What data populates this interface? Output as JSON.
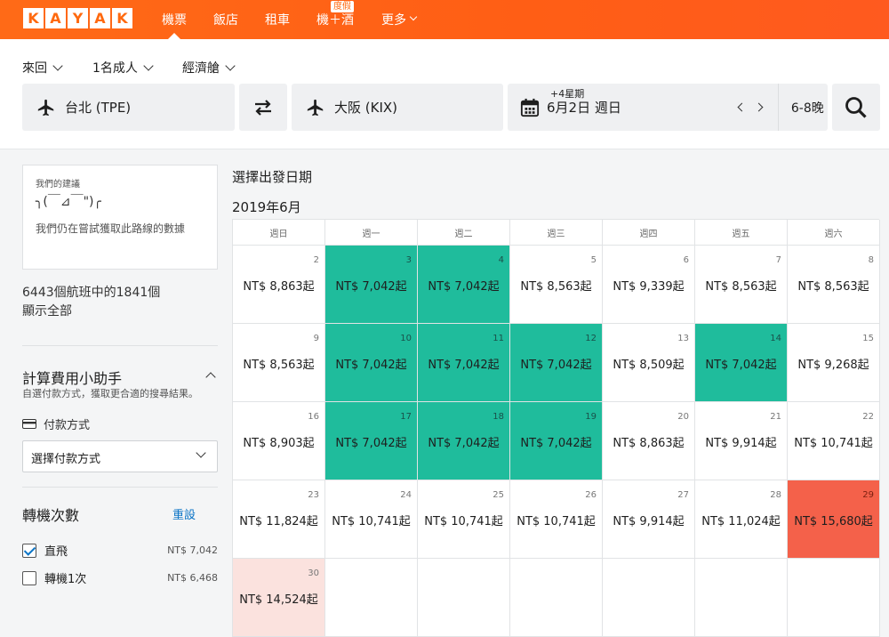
{
  "brand": {
    "letters": [
      "K",
      "A",
      "Y",
      "A",
      "K"
    ]
  },
  "nav": {
    "items": [
      {
        "label": "機票",
        "active": true
      },
      {
        "label": "飯店"
      },
      {
        "label": "租車"
      },
      {
        "label": "機＋酒",
        "badge": "度假"
      },
      {
        "label": "更多"
      }
    ]
  },
  "search": {
    "trip_type": "來回",
    "travelers": "1名成人",
    "cabin": "經濟艙",
    "origin": "台北 (TPE)",
    "destination": "大阪 (KIX)",
    "date": "6月2日 週日",
    "date_flex": "+4星期",
    "duration": "6-8晚"
  },
  "sidebar": {
    "advice_heading": "我們的建議",
    "advice_face": "╮(￣⊿￣\")╭",
    "advice_msg": "我們仍在嘗試獲取此路線的數據",
    "flight_count": "6443個航班中的1841個",
    "show_all": "顯示全部",
    "calc_title": "計算費用小助手",
    "calc_desc": "自選付款方式，獲取更合適的搜尋結果。",
    "payment_label": "付款方式",
    "payment_select": "選擇付款方式",
    "stops_title": "轉機次數",
    "reset": "重設",
    "stops": [
      {
        "label": "直飛",
        "price": "NT$ 7,042",
        "checked": true
      },
      {
        "label": "轉機1次",
        "price": "NT$ 6,468",
        "checked": false
      }
    ]
  },
  "calendar": {
    "title": "選擇出發日期",
    "month": "2019年6月",
    "weekdays": [
      "週日",
      "週一",
      "週二",
      "週三",
      "週四",
      "週五",
      "週六"
    ],
    "rows": [
      [
        {
          "day": "2",
          "price": "NT$ 8,863起",
          "level": "normal"
        },
        {
          "day": "3",
          "price": "NT$ 7,042起",
          "level": "low"
        },
        {
          "day": "4",
          "price": "NT$ 7,042起",
          "level": "low"
        },
        {
          "day": "5",
          "price": "NT$ 8,563起",
          "level": "normal"
        },
        {
          "day": "6",
          "price": "NT$ 9,339起",
          "level": "normal"
        },
        {
          "day": "7",
          "price": "NT$ 8,563起",
          "level": "normal"
        },
        {
          "day": "8",
          "price": "NT$ 8,563起",
          "level": "normal"
        }
      ],
      [
        {
          "day": "9",
          "price": "NT$ 8,563起",
          "level": "normal"
        },
        {
          "day": "10",
          "price": "NT$ 7,042起",
          "level": "low"
        },
        {
          "day": "11",
          "price": "NT$ 7,042起",
          "level": "low"
        },
        {
          "day": "12",
          "price": "NT$ 7,042起",
          "level": "low"
        },
        {
          "day": "13",
          "price": "NT$ 8,509起",
          "level": "normal"
        },
        {
          "day": "14",
          "price": "NT$ 7,042起",
          "level": "low"
        },
        {
          "day": "15",
          "price": "NT$ 9,268起",
          "level": "normal"
        }
      ],
      [
        {
          "day": "16",
          "price": "NT$ 8,903起",
          "level": "normal"
        },
        {
          "day": "17",
          "price": "NT$ 7,042起",
          "level": "low"
        },
        {
          "day": "18",
          "price": "NT$ 7,042起",
          "level": "low"
        },
        {
          "day": "19",
          "price": "NT$ 7,042起",
          "level": "low"
        },
        {
          "day": "20",
          "price": "NT$ 8,863起",
          "level": "normal"
        },
        {
          "day": "21",
          "price": "NT$ 9,914起",
          "level": "normal"
        },
        {
          "day": "22",
          "price": "NT$ 10,741起",
          "level": "normal"
        }
      ],
      [
        {
          "day": "23",
          "price": "NT$ 11,824起",
          "level": "normal"
        },
        {
          "day": "24",
          "price": "NT$ 10,741起",
          "level": "normal"
        },
        {
          "day": "25",
          "price": "NT$ 10,741起",
          "level": "normal"
        },
        {
          "day": "26",
          "price": "NT$ 10,741起",
          "level": "normal"
        },
        {
          "day": "27",
          "price": "NT$ 9,914起",
          "level": "normal"
        },
        {
          "day": "28",
          "price": "NT$ 11,024起",
          "level": "normal"
        },
        {
          "day": "29",
          "price": "NT$ 15,680起",
          "level": "high"
        }
      ],
      [
        {
          "day": "30",
          "price": "NT$ 14,524起",
          "level": "mid"
        },
        {
          "day": "",
          "price": "",
          "level": "empty"
        },
        {
          "day": "",
          "price": "",
          "level": "empty"
        },
        {
          "day": "",
          "price": "",
          "level": "empty"
        },
        {
          "day": "",
          "price": "",
          "level": "empty"
        },
        {
          "day": "",
          "price": "",
          "level": "empty"
        },
        {
          "day": "",
          "price": "",
          "level": "empty"
        }
      ]
    ]
  },
  "colors": {
    "brand": "#ff690f",
    "cheap": "#1fbc9c",
    "expensive": "#f4614a",
    "link": "#0b74c6"
  }
}
